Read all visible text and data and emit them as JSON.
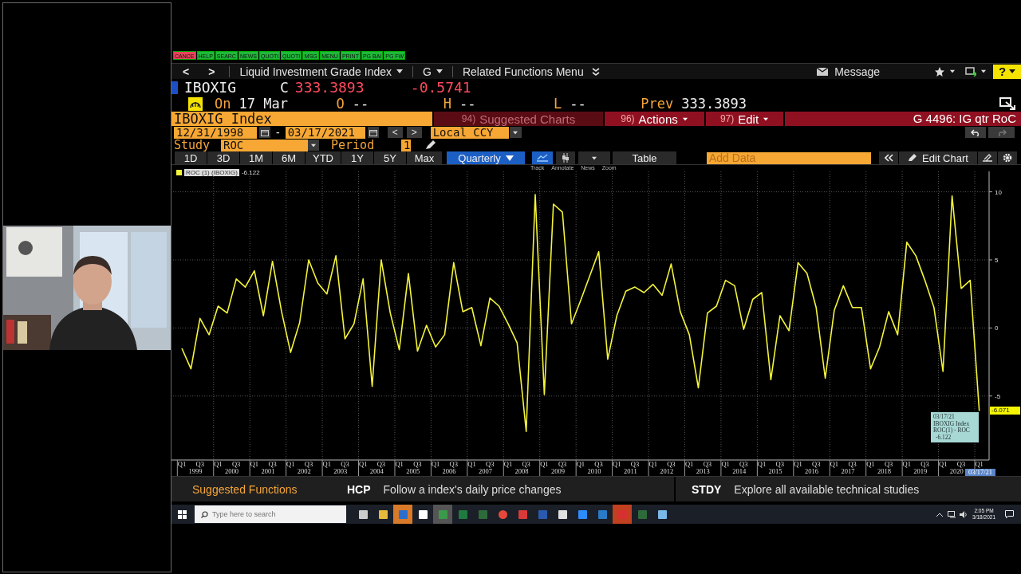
{
  "function_keys": [
    {
      "label": "CANCE",
      "color": "#e8455a"
    },
    {
      "label": "HELP",
      "color": "#1fb83a"
    },
    {
      "label": "SEARC",
      "color": "#1fb83a"
    },
    {
      "label": "NEWS",
      "color": "#1fb83a"
    },
    {
      "label": "QUOTI",
      "color": "#1fb83a"
    },
    {
      "label": "QUOTI",
      "color": "#1fb83a"
    },
    {
      "label": "MSG",
      "color": "#1fb83a"
    },
    {
      "label": "MENU",
      "color": "#1fb83a"
    },
    {
      "label": "PRINT",
      "color": "#1fb83a"
    },
    {
      "label": "PG BAI",
      "color": "#1fb83a"
    },
    {
      "label": "PG FW",
      "color": "#1fb83a"
    }
  ],
  "nav": {
    "back": "<",
    "forward": ">",
    "security_menu": "Liquid Investment Grade Index",
    "g_menu": "G",
    "related": "Related Functions Menu",
    "message": "Message",
    "help": "?"
  },
  "quote": {
    "ticker": "IBOXIG",
    "close_label": "C",
    "close": "333.3893",
    "change": "-0.5741",
    "on_label": "On",
    "date": "17 Mar",
    "open_label": "O",
    "open": "--",
    "high_label": "H",
    "high": "--",
    "low_label": "L",
    "low": "--",
    "prev_label": "Prev",
    "prev": "333.3893"
  },
  "title_bar": {
    "security": "IBOXIG Index",
    "chart_name": "G 4496: IG qtr RoC",
    "menus": [
      {
        "number": "94)",
        "label": "Suggested Charts",
        "disabled": true
      },
      {
        "number": "96)",
        "label": "Actions",
        "disabled": false
      },
      {
        "number": "97)",
        "label": "Edit",
        "disabled": false
      }
    ]
  },
  "dates": {
    "start": "12/31/1998",
    "separator": "-",
    "end": "03/17/2021",
    "prev": "<",
    "next": ">",
    "currency": "Local CCY"
  },
  "study": {
    "label": "Study",
    "value": "ROC",
    "period_label": "Period",
    "period": "1"
  },
  "ranges": [
    {
      "label": "1D",
      "kind": "button",
      "selected": false
    },
    {
      "label": "3D",
      "kind": "button",
      "selected": false
    },
    {
      "label": "1M",
      "kind": "button",
      "selected": false
    },
    {
      "label": "6M",
      "kind": "button",
      "selected": false
    },
    {
      "label": "YTD",
      "kind": "button",
      "selected": false
    },
    {
      "label": "1Y",
      "kind": "button",
      "selected": false
    },
    {
      "label": "5Y",
      "kind": "button",
      "selected": false
    },
    {
      "label": "Max",
      "kind": "button",
      "selected": false
    },
    {
      "label": "Quarterly",
      "kind": "dropdown",
      "selected": true
    }
  ],
  "chart_tools": {
    "table": "Table",
    "add_data_placeholder": "Add Data",
    "edit_chart": "Edit Chart",
    "labels": [
      "Track",
      "Annotate",
      "News",
      "Zoom"
    ]
  },
  "legend": {
    "value": "-6.122"
  },
  "chart_data": {
    "type": "line",
    "grid": true,
    "ylim": [
      -9.7,
      11.5
    ],
    "yticks": [
      -5,
      0,
      5,
      10
    ],
    "series": [
      {
        "name": "ROC (1) (IBOXIG)",
        "color": "#f4f43a",
        "values": [
          -1.5,
          -3,
          0.7,
          -0.5,
          1.6,
          1.1,
          3.6,
          3,
          4.2,
          0.9,
          4.9,
          1.2,
          -1.8,
          0.4,
          5,
          3.3,
          2.5,
          5.3,
          -0.8,
          0.3,
          3.6,
          -4.3,
          5,
          1.1,
          -1.6,
          4,
          -1.7,
          0.2,
          -1.4,
          -0.5,
          4.8,
          1.2,
          1.5,
          -1.3,
          2.2,
          1.6,
          0.3,
          -1.1,
          -7.6,
          9.8,
          -4.9,
          9.1,
          8.5,
          0.3,
          2,
          3.8,
          5.6,
          -2.3,
          0.9,
          2.7,
          3,
          2.6,
          3.2,
          2.4,
          4.7,
          1.2,
          -0.5,
          -4.4,
          1.1,
          1.6,
          3.5,
          3.1,
          -0.1,
          2.1,
          2.6,
          -3.8,
          0.9,
          -0.2,
          4.8,
          4,
          1.5,
          -3.7,
          1.3,
          3.1,
          1.5,
          1.5,
          -3,
          -1.4,
          1.2,
          -0.5,
          6.3,
          5.3,
          3.5,
          1.5,
          -3.2,
          9.7,
          2.9,
          3.5,
          -6.1
        ]
      }
    ]
  },
  "x_axis": [
    {
      "q1": "Q1",
      "q3": "Q3",
      "year": "1999"
    },
    {
      "q1": "Q1",
      "q3": "Q3",
      "year": "2000"
    },
    {
      "q1": "Q1",
      "q3": "Q3",
      "year": "2001"
    },
    {
      "q1": "Q1",
      "q3": "Q3",
      "year": "2002"
    },
    {
      "q1": "Q1",
      "q3": "Q3",
      "year": "2003"
    },
    {
      "q1": "Q1",
      "q3": "Q3",
      "year": "2004"
    },
    {
      "q1": "Q1",
      "q3": "Q3",
      "year": "2005"
    },
    {
      "q1": "Q1",
      "q3": "Q3",
      "year": "2006"
    },
    {
      "q1": "Q1",
      "q3": "Q3",
      "year": "2007"
    },
    {
      "q1": "Q1",
      "q3": "Q3",
      "year": "2008"
    },
    {
      "q1": "Q1",
      "q3": "Q3",
      "year": "2009"
    },
    {
      "q1": "Q1",
      "q3": "Q3",
      "year": "2010"
    },
    {
      "q1": "Q1",
      "q3": "Q3",
      "year": "2011"
    },
    {
      "q1": "Q1",
      "q3": "Q3",
      "year": "2012"
    },
    {
      "q1": "Q1",
      "q3": "Q3",
      "year": "2013"
    },
    {
      "q1": "Q1",
      "q3": "Q3",
      "year": "2014"
    },
    {
      "q1": "Q1",
      "q3": "Q3",
      "year": "2015"
    },
    {
      "q1": "Q1",
      "q3": "Q3",
      "year": "2016"
    },
    {
      "q1": "Q1",
      "q3": "Q3",
      "year": "2017"
    },
    {
      "q1": "Q1",
      "q3": "Q3",
      "year": "2018"
    },
    {
      "q1": "Q1",
      "q3": "Q3",
      "year": "2019"
    },
    {
      "q1": "Q1",
      "q3": "Q3",
      "year": "2020"
    }
  ],
  "x_axis_end": {
    "q1": "Q1",
    "date_tag": "03/17/21"
  },
  "last_value": "-6.071",
  "tooltip": {
    "date": "03/17/21",
    "security": "IBOXIG Index",
    "study": "ROC(1) - ROC",
    "value": "-6.122"
  },
  "suggested_functions": {
    "title": "Suggested Functions",
    "items": [
      {
        "code": "HCP",
        "description": "Follow a index's daily price changes"
      },
      {
        "code": "STDY",
        "description": "Explore all available technical studies"
      }
    ]
  },
  "taskbar": {
    "search_placeholder": "Type here to search",
    "time": "2:05 PM",
    "date": "3/18/2021"
  }
}
